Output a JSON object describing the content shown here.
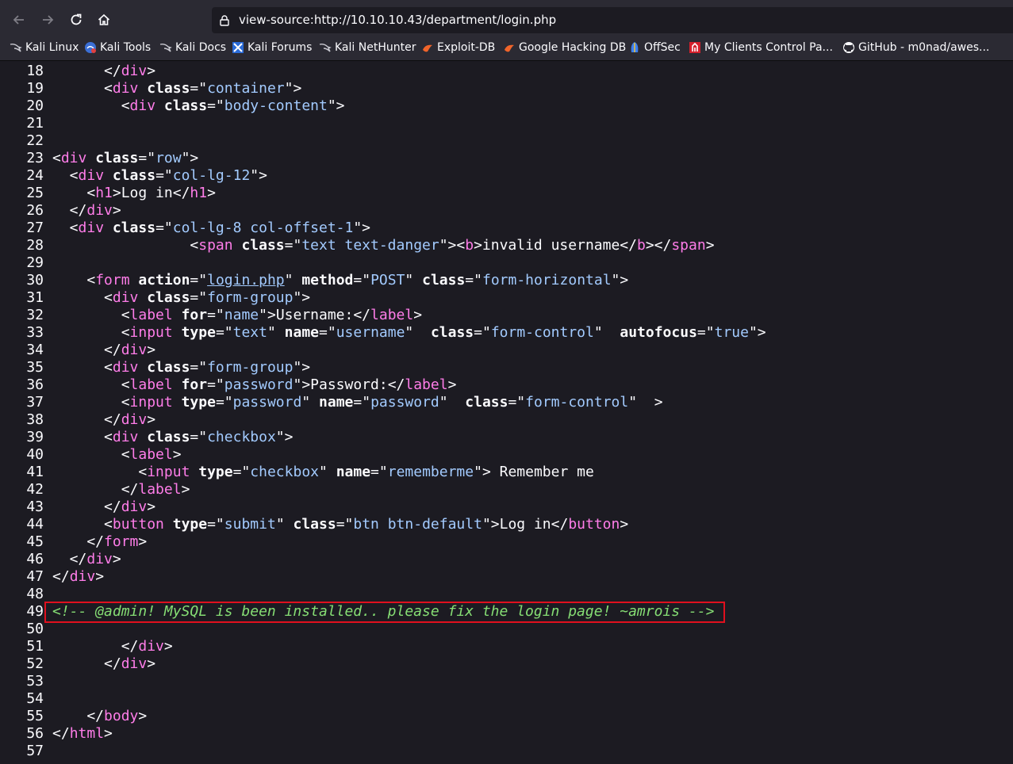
{
  "browser": {
    "url": "view-source:http://10.10.10.43/department/login.php",
    "bookmarks": [
      {
        "label": "Kali Linux",
        "icon": "kali-dragon-icon"
      },
      {
        "label": "Kali Tools",
        "icon": "kali-tools-icon"
      },
      {
        "label": "Kali Docs",
        "icon": "kali-dragon-icon"
      },
      {
        "label": "Kali Forums",
        "icon": "kali-forums-icon"
      },
      {
        "label": "Kali NetHunter",
        "icon": "kali-dragon-icon"
      },
      {
        "label": "Exploit-DB",
        "icon": "exploit-db-icon"
      },
      {
        "label": "Google Hacking DB",
        "icon": "ghdb-icon"
      },
      {
        "label": "OffSec",
        "icon": "offsec-icon"
      },
      {
        "label": "My Clients Control Pa...",
        "icon": "clients-icon"
      },
      {
        "label": "GitHub - m0nad/awes...",
        "icon": "github-icon"
      }
    ]
  },
  "source": {
    "line_numbers": [
      "18",
      "19",
      "20",
      "21",
      "22",
      "23",
      "24",
      "25",
      "26",
      "27",
      "28",
      "29",
      "30",
      "31",
      "32",
      "33",
      "34",
      "35",
      "36",
      "37",
      "38",
      "39",
      "40",
      "41",
      "42",
      "43",
      "44",
      "45",
      "46",
      "47",
      "48",
      "49",
      "50",
      "51",
      "52",
      "53",
      "54",
      "55",
      "56",
      "57"
    ],
    "highlighted_line": "49",
    "comment": "<!-- @admin! MySQL is been installed.. please fix the login page! ~amrois -->"
  },
  "colors": {
    "tag": "#ff7de9",
    "attr_value": "#a3cbff",
    "comment": "#86de74",
    "highlight_box": "#e0101e"
  }
}
